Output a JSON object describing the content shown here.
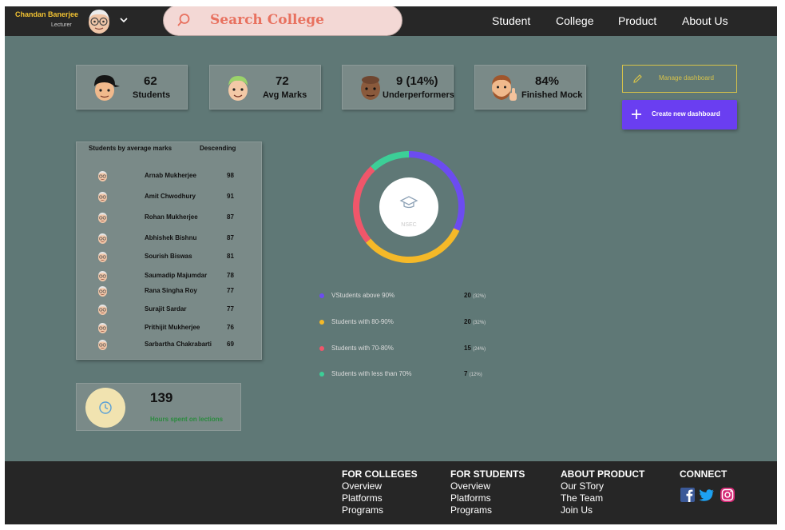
{
  "header": {
    "user_name": "Chandan Banerjee",
    "user_role": "Lecturer",
    "search_placeholder": "Search College",
    "nav": [
      "Student",
      "College",
      "Product",
      "About Us"
    ]
  },
  "stats": [
    {
      "value": "62",
      "label": "Students"
    },
    {
      "value": "72",
      "label": "Avg Marks"
    },
    {
      "value": "9 (14%)",
      "label": "Underperformers"
    },
    {
      "value": "84%",
      "label": "Finished Mock"
    }
  ],
  "actions": {
    "manage_label": "Manage dashboard",
    "create_label": "Create new dashboard"
  },
  "leaderboard": {
    "title": "Students by average marks",
    "sort": "Descending",
    "rows": [
      {
        "name": "Arnab Mukherjee",
        "score": "98"
      },
      {
        "name": "Amit Chwodhury",
        "score": "91"
      },
      {
        "name": "Rohan Mukherjee",
        "score": "87"
      },
      {
        "name": "Abhishek Bishnu",
        "score": "87"
      },
      {
        "name": "Sourish Biswas",
        "score": "81"
      },
      {
        "name": "Saumadip Majumdar",
        "score": "78"
      },
      {
        "name": "Rana Singha Roy",
        "score": "77"
      },
      {
        "name": "Surajit Sardar",
        "score": "77"
      },
      {
        "name": "Prithijit Mukherjee",
        "score": "76"
      },
      {
        "name": "Sarbartha Chakrabarti",
        "score": "69"
      }
    ]
  },
  "hours": {
    "value": "139",
    "label": "Hours spent on lections"
  },
  "distribution": {
    "center_label": "NSEC",
    "segments": [
      {
        "label": "VStudents above 90%",
        "count": "20",
        "pct": "(32%)",
        "color": "#6c4cf0",
        "value": 32
      },
      {
        "label": "Students with 80-90%",
        "count": "20",
        "pct": "(32%)",
        "color": "#f5b928",
        "value": 32
      },
      {
        "label": "Students with 70-80%",
        "count": "15",
        "pct": "(24%)",
        "color": "#f0566a",
        "value": 24
      },
      {
        "label": "Students with less than 70%",
        "count": "7",
        "pct": "(12%)",
        "color": "#3ccf97",
        "value": 12
      }
    ]
  },
  "footer": {
    "columns": [
      {
        "title": "FOR COLLEGES",
        "links": [
          "Overview",
          "Platforms",
          "Programs"
        ]
      },
      {
        "title": "FOR STUDENTS",
        "links": [
          "Overview",
          "Platforms",
          "Programs"
        ]
      },
      {
        "title": "ABOUT PRODUCT",
        "links": [
          "Our STory",
          "The Team",
          "Join Us"
        ]
      },
      {
        "title": "CONNECT",
        "links": []
      }
    ],
    "social": [
      "facebook-icon",
      "twitter-icon",
      "instagram-icon"
    ]
  },
  "colors": {
    "background": "#5f7876",
    "header": "#272727",
    "accent": "#6a3ef1",
    "search_text": "#e8715f",
    "user_name": "#f1c232"
  }
}
